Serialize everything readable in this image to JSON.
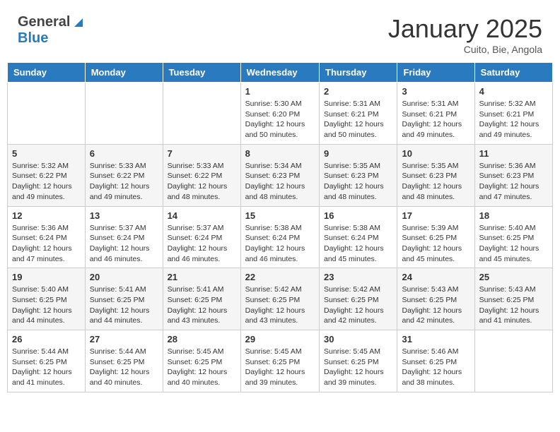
{
  "header": {
    "logo_general": "General",
    "logo_blue": "Blue",
    "month": "January 2025",
    "location": "Cuito, Bie, Angola"
  },
  "days_of_week": [
    "Sunday",
    "Monday",
    "Tuesday",
    "Wednesday",
    "Thursday",
    "Friday",
    "Saturday"
  ],
  "weeks": [
    [
      {
        "day": "",
        "info": ""
      },
      {
        "day": "",
        "info": ""
      },
      {
        "day": "",
        "info": ""
      },
      {
        "day": "1",
        "info": "Sunrise: 5:30 AM\nSunset: 6:20 PM\nDaylight: 12 hours\nand 50 minutes."
      },
      {
        "day": "2",
        "info": "Sunrise: 5:31 AM\nSunset: 6:21 PM\nDaylight: 12 hours\nand 50 minutes."
      },
      {
        "day": "3",
        "info": "Sunrise: 5:31 AM\nSunset: 6:21 PM\nDaylight: 12 hours\nand 49 minutes."
      },
      {
        "day": "4",
        "info": "Sunrise: 5:32 AM\nSunset: 6:21 PM\nDaylight: 12 hours\nand 49 minutes."
      }
    ],
    [
      {
        "day": "5",
        "info": "Sunrise: 5:32 AM\nSunset: 6:22 PM\nDaylight: 12 hours\nand 49 minutes."
      },
      {
        "day": "6",
        "info": "Sunrise: 5:33 AM\nSunset: 6:22 PM\nDaylight: 12 hours\nand 49 minutes."
      },
      {
        "day": "7",
        "info": "Sunrise: 5:33 AM\nSunset: 6:22 PM\nDaylight: 12 hours\nand 48 minutes."
      },
      {
        "day": "8",
        "info": "Sunrise: 5:34 AM\nSunset: 6:23 PM\nDaylight: 12 hours\nand 48 minutes."
      },
      {
        "day": "9",
        "info": "Sunrise: 5:35 AM\nSunset: 6:23 PM\nDaylight: 12 hours\nand 48 minutes."
      },
      {
        "day": "10",
        "info": "Sunrise: 5:35 AM\nSunset: 6:23 PM\nDaylight: 12 hours\nand 48 minutes."
      },
      {
        "day": "11",
        "info": "Sunrise: 5:36 AM\nSunset: 6:23 PM\nDaylight: 12 hours\nand 47 minutes."
      }
    ],
    [
      {
        "day": "12",
        "info": "Sunrise: 5:36 AM\nSunset: 6:24 PM\nDaylight: 12 hours\nand 47 minutes."
      },
      {
        "day": "13",
        "info": "Sunrise: 5:37 AM\nSunset: 6:24 PM\nDaylight: 12 hours\nand 46 minutes."
      },
      {
        "day": "14",
        "info": "Sunrise: 5:37 AM\nSunset: 6:24 PM\nDaylight: 12 hours\nand 46 minutes."
      },
      {
        "day": "15",
        "info": "Sunrise: 5:38 AM\nSunset: 6:24 PM\nDaylight: 12 hours\nand 46 minutes."
      },
      {
        "day": "16",
        "info": "Sunrise: 5:38 AM\nSunset: 6:24 PM\nDaylight: 12 hours\nand 45 minutes."
      },
      {
        "day": "17",
        "info": "Sunrise: 5:39 AM\nSunset: 6:25 PM\nDaylight: 12 hours\nand 45 minutes."
      },
      {
        "day": "18",
        "info": "Sunrise: 5:40 AM\nSunset: 6:25 PM\nDaylight: 12 hours\nand 45 minutes."
      }
    ],
    [
      {
        "day": "19",
        "info": "Sunrise: 5:40 AM\nSunset: 6:25 PM\nDaylight: 12 hours\nand 44 minutes."
      },
      {
        "day": "20",
        "info": "Sunrise: 5:41 AM\nSunset: 6:25 PM\nDaylight: 12 hours\nand 44 minutes."
      },
      {
        "day": "21",
        "info": "Sunrise: 5:41 AM\nSunset: 6:25 PM\nDaylight: 12 hours\nand 43 minutes."
      },
      {
        "day": "22",
        "info": "Sunrise: 5:42 AM\nSunset: 6:25 PM\nDaylight: 12 hours\nand 43 minutes."
      },
      {
        "day": "23",
        "info": "Sunrise: 5:42 AM\nSunset: 6:25 PM\nDaylight: 12 hours\nand 42 minutes."
      },
      {
        "day": "24",
        "info": "Sunrise: 5:43 AM\nSunset: 6:25 PM\nDaylight: 12 hours\nand 42 minutes."
      },
      {
        "day": "25",
        "info": "Sunrise: 5:43 AM\nSunset: 6:25 PM\nDaylight: 12 hours\nand 41 minutes."
      }
    ],
    [
      {
        "day": "26",
        "info": "Sunrise: 5:44 AM\nSunset: 6:25 PM\nDaylight: 12 hours\nand 41 minutes."
      },
      {
        "day": "27",
        "info": "Sunrise: 5:44 AM\nSunset: 6:25 PM\nDaylight: 12 hours\nand 40 minutes."
      },
      {
        "day": "28",
        "info": "Sunrise: 5:45 AM\nSunset: 6:25 PM\nDaylight: 12 hours\nand 40 minutes."
      },
      {
        "day": "29",
        "info": "Sunrise: 5:45 AM\nSunset: 6:25 PM\nDaylight: 12 hours\nand 39 minutes."
      },
      {
        "day": "30",
        "info": "Sunrise: 5:45 AM\nSunset: 6:25 PM\nDaylight: 12 hours\nand 39 minutes."
      },
      {
        "day": "31",
        "info": "Sunrise: 5:46 AM\nSunset: 6:25 PM\nDaylight: 12 hours\nand 38 minutes."
      },
      {
        "day": "",
        "info": ""
      }
    ]
  ]
}
